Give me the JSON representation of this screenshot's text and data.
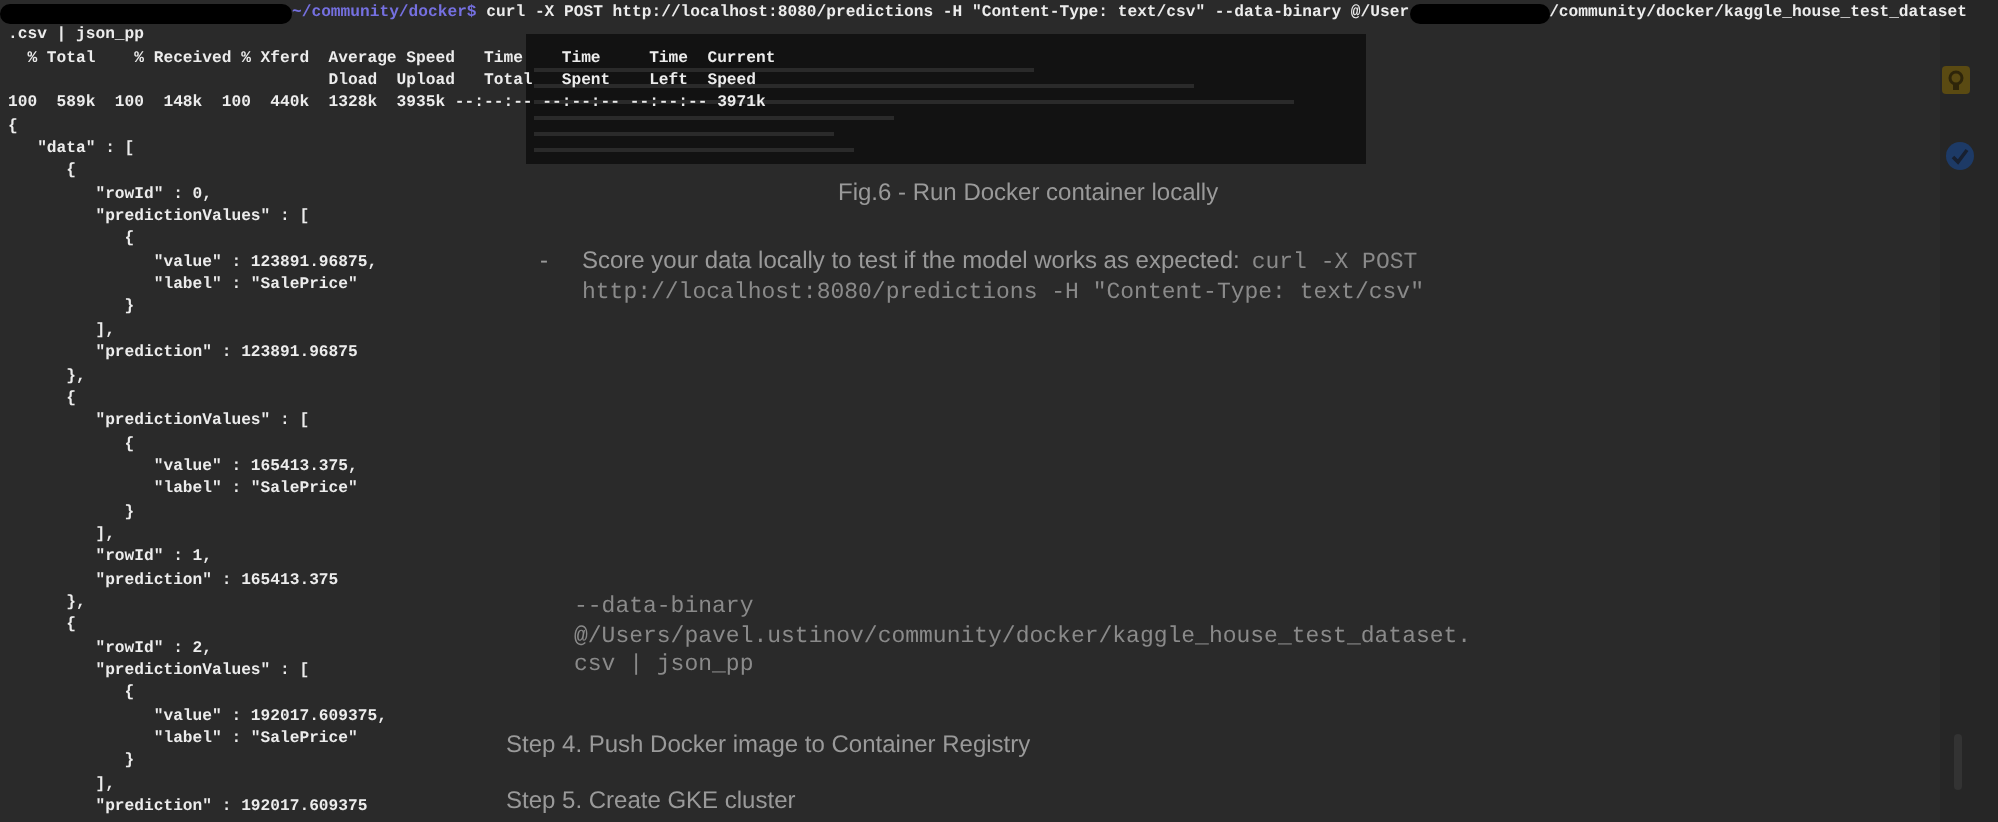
{
  "terminal": {
    "command": {
      "path": "~/community/docker$",
      "before": " curl -X POST http://localhost:8080/predictions -H \"Content-Type: text/csv\" --data-binary @/User",
      "after": "/community/docker/kaggle_house_test_dataset"
    },
    "output_lines": [
      ".csv | json_pp",
      "  % Total    % Received % Xferd  Average Speed   Time    Time     Time  Current",
      "                                 Dload  Upload   Total   Spent    Left  Speed",
      "100  589k  100  148k  100  440k  1328k  3935k --:--:-- --:--:-- --:--:-- 3971k",
      "{",
      "   \"data\" : [",
      "      {",
      "         \"rowId\" : 0,",
      "         \"predictionValues\" : [",
      "            {",
      "               \"value\" : 123891.96875,",
      "               \"label\" : \"SalePrice\"",
      "            }",
      "         ],",
      "         \"prediction\" : 123891.96875",
      "      },",
      "      {",
      "         \"predictionValues\" : [",
      "            {",
      "               \"value\" : 165413.375,",
      "               \"label\" : \"SalePrice\"",
      "            }",
      "         ],",
      "         \"rowId\" : 1,",
      "         \"prediction\" : 165413.375",
      "      },",
      "      {",
      "         \"rowId\" : 2,",
      "         \"predictionValues\" : [",
      "            {",
      "               \"value\" : 192017.609375,",
      "               \"label\" : \"SalePrice\"",
      "            }",
      "         ],",
      "         \"prediction\" : 192017.609375"
    ]
  },
  "document": {
    "caption": "Fig.6 - Run Docker container locally",
    "bullet": {
      "marker": "-",
      "text": "Score your data locally to test if the model works as expected:",
      "code_inline": "curl -X POST",
      "code_line": "http://localhost:8080/predictions -H \"Content-Type: text/csv\""
    },
    "code_lines": [
      "--data-binary",
      "@/Users/pavel.ustinov/community/docker/kaggle_house_test_dataset.",
      "csv | json_pp"
    ],
    "steps": [
      "Step 4. Push Docker image to Container Registry",
      "Step 5. Create GKE cluster"
    ]
  }
}
